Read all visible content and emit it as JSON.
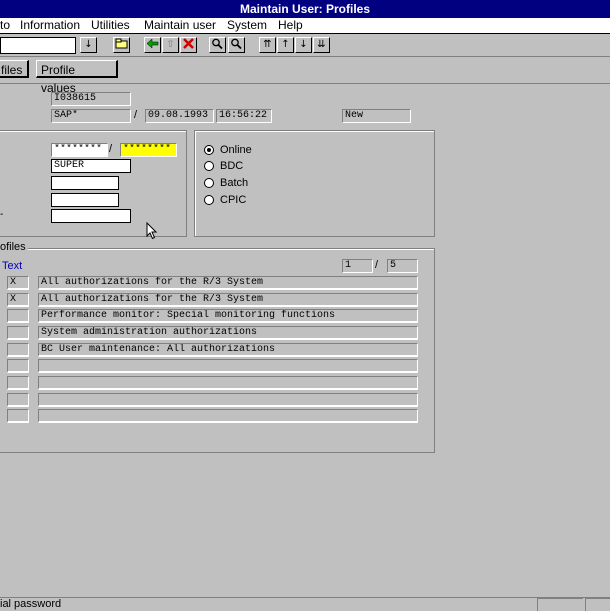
{
  "window": {
    "title": "Maintain User: Profiles"
  },
  "menu": [
    "to",
    "Information",
    "Utilities",
    "Maintain user",
    "System",
    "Help"
  ],
  "toolbar": {
    "icons": [
      "dropdown-icon",
      "folder-icon",
      "back-icon",
      "exit-icon",
      "cancel-icon",
      "find-icon",
      "find-next-icon",
      "first-page-icon",
      "prev-page-icon",
      "next-page-icon",
      "last-page-icon"
    ]
  },
  "app_toolbar": {
    "profiles_label": "files",
    "profile_values_label": "Profile values"
  },
  "header": {
    "user": "I038615",
    "created_by": "SAP*",
    "date": "09.08.1993",
    "time": "16:56:22",
    "status": "New"
  },
  "logon": {
    "password": "********",
    "password_repeat": "********",
    "profile": "SUPER"
  },
  "user_type": {
    "options": [
      "Online",
      "BDC",
      "Batch",
      "CPIC"
    ],
    "selected": "Online"
  },
  "profiles": {
    "group_label": "ofiles",
    "text_header": "Text",
    "page_current": "1",
    "page_total": "5",
    "rows": [
      {
        "mark": "X",
        "text": "All authorizations for the R/3 System"
      },
      {
        "mark": "X",
        "text": "All authorizations for the R/3 System"
      },
      {
        "mark": "",
        "text": "Performance monitor: Special monitoring functions"
      },
      {
        "mark": "",
        "text": "System administration authorizations"
      },
      {
        "mark": "",
        "text": "BC User maintenance: All authorizations"
      },
      {
        "mark": "",
        "text": ""
      },
      {
        "mark": "",
        "text": ""
      },
      {
        "mark": "",
        "text": ""
      },
      {
        "mark": "",
        "text": ""
      }
    ]
  },
  "status": {
    "message": "ial password"
  },
  "colors": {
    "titlebar": "#000080",
    "window_bg": "#c0c0c0",
    "highlight": "#ffff00",
    "link_blue": "#0000c0"
  }
}
